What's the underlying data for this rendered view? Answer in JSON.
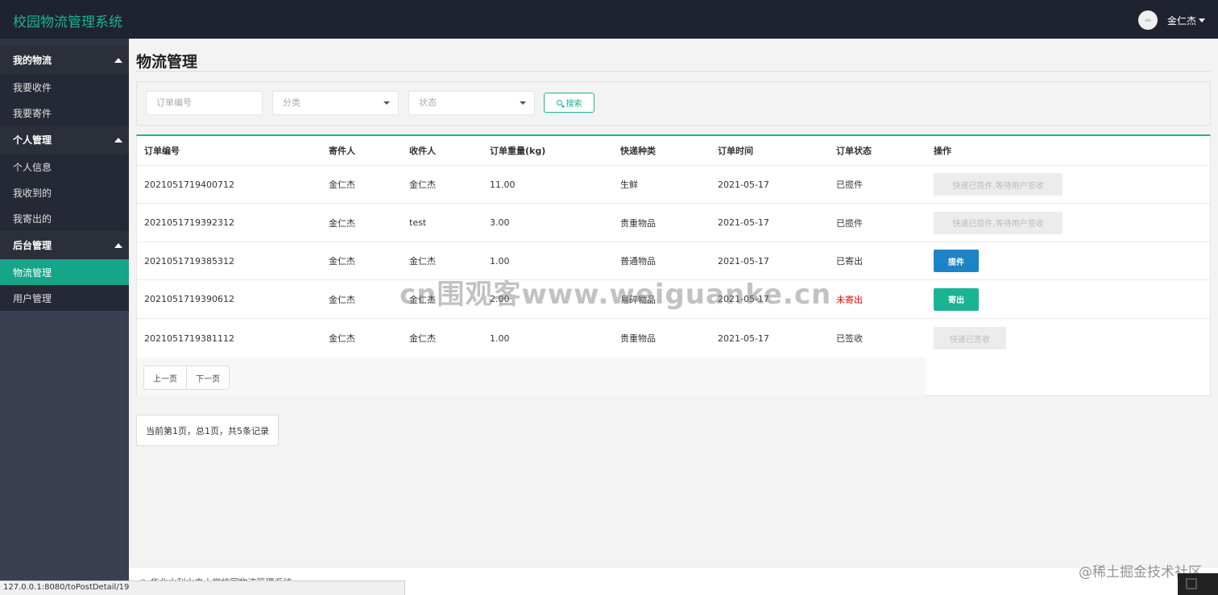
{
  "app": {
    "title": "校园物流管理系统"
  },
  "user": {
    "name": "金仁杰"
  },
  "sidebar": {
    "groups": [
      {
        "label": "我的物流",
        "items": [
          {
            "label": "我要收件"
          },
          {
            "label": "我要寄件"
          }
        ]
      },
      {
        "label": "个人管理",
        "items": [
          {
            "label": "个人信息"
          },
          {
            "label": "我收到的"
          },
          {
            "label": "我寄出的"
          }
        ]
      },
      {
        "label": "后台管理",
        "items": [
          {
            "label": "物流管理",
            "active": true
          },
          {
            "label": "用户管理"
          }
        ]
      }
    ]
  },
  "page": {
    "title": "物流管理"
  },
  "filters": {
    "order_no_placeholder": "订单编号",
    "category_placeholder": "分类",
    "status_placeholder": "状态",
    "search_label": "搜索"
  },
  "table": {
    "headers": [
      "订单编号",
      "寄件人",
      "收件人",
      "订单重量(kg)",
      "快递种类",
      "订单时间",
      "订单状态",
      "操作"
    ],
    "rows": [
      {
        "order_no": "2021051719400712",
        "sender": "金仁杰",
        "receiver": "金仁杰",
        "weight": "11.00",
        "type": "生鲜",
        "date": "2021-05-17",
        "status": "已揽件",
        "action": "快递已揽件,等待用户签收",
        "action_style": "disabled"
      },
      {
        "order_no": "2021051719392312",
        "sender": "金仁杰",
        "receiver": "test",
        "weight": "3.00",
        "type": "贵重物品",
        "date": "2021-05-17",
        "status": "已揽件",
        "action": "快递已揽件,等待用户签收",
        "action_style": "disabled"
      },
      {
        "order_no": "2021051719385312",
        "sender": "金仁杰",
        "receiver": "金仁杰",
        "weight": "1.00",
        "type": "普通物品",
        "date": "2021-05-17",
        "status": "已寄出",
        "action": "揽件",
        "action_style": "primary"
      },
      {
        "order_no": "2021051719390612",
        "sender": "金仁杰",
        "receiver": "金仁杰",
        "weight": "2.00",
        "type": "易碎物品",
        "date": "2021-05-17",
        "status": "未寄出",
        "status_color": "#e00000",
        "action": "寄出",
        "action_style": "success"
      },
      {
        "order_no": "2021051719381112",
        "sender": "金仁杰",
        "receiver": "金仁杰",
        "weight": "1.00",
        "type": "贵重物品",
        "date": "2021-05-17",
        "status": "已签收",
        "action": "快递已签收",
        "action_style": "disabled"
      }
    ]
  },
  "pagination": {
    "prev_label": "上一页",
    "next_label": "下一页",
    "summary": "当前第1页，总1页，共5条记录"
  },
  "footer": {
    "text": "© 华北水利水电大学校园物流管理系统"
  },
  "browser_status": {
    "url": "127.0.0.1:8080/toPostDetail/19"
  },
  "overlays": {
    "watermark": "cn围观客www.weiguanke.cn",
    "credit": "@稀土掘金技术社区"
  },
  "colors": {
    "accent": "#1ab394",
    "primary": "#1c84c6",
    "topbar": "#1f2330",
    "sidebar": "#3a3f51",
    "danger": "#e00000"
  }
}
